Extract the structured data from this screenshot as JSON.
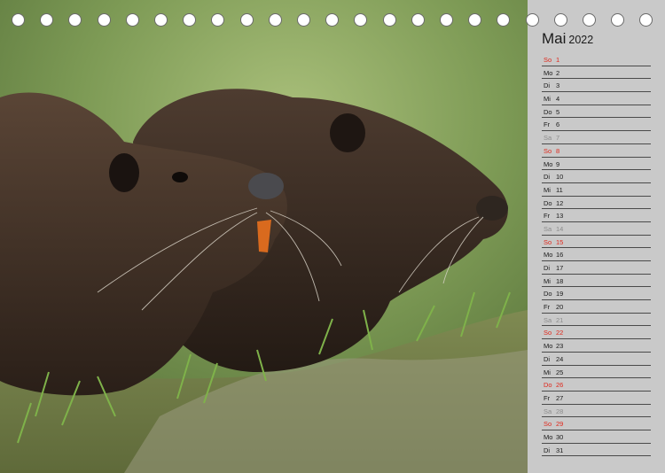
{
  "calendar": {
    "month": "Mai",
    "year": "2022",
    "days": [
      {
        "wd": "So",
        "num": "1",
        "type": "sun"
      },
      {
        "wd": "Mo",
        "num": "2",
        "type": "work"
      },
      {
        "wd": "Di",
        "num": "3",
        "type": "work"
      },
      {
        "wd": "Mi",
        "num": "4",
        "type": "work"
      },
      {
        "wd": "Do",
        "num": "5",
        "type": "work"
      },
      {
        "wd": "Fr",
        "num": "6",
        "type": "work"
      },
      {
        "wd": "Sa",
        "num": "7",
        "type": "sat"
      },
      {
        "wd": "So",
        "num": "8",
        "type": "sun"
      },
      {
        "wd": "Mo",
        "num": "9",
        "type": "work"
      },
      {
        "wd": "Di",
        "num": "10",
        "type": "work"
      },
      {
        "wd": "Mi",
        "num": "11",
        "type": "work"
      },
      {
        "wd": "Do",
        "num": "12",
        "type": "work"
      },
      {
        "wd": "Fr",
        "num": "13",
        "type": "work"
      },
      {
        "wd": "Sa",
        "num": "14",
        "type": "sat"
      },
      {
        "wd": "So",
        "num": "15",
        "type": "sun"
      },
      {
        "wd": "Mo",
        "num": "16",
        "type": "work"
      },
      {
        "wd": "Di",
        "num": "17",
        "type": "work"
      },
      {
        "wd": "Mi",
        "num": "18",
        "type": "work"
      },
      {
        "wd": "Do",
        "num": "19",
        "type": "work"
      },
      {
        "wd": "Fr",
        "num": "20",
        "type": "work"
      },
      {
        "wd": "Sa",
        "num": "21",
        "type": "sat"
      },
      {
        "wd": "So",
        "num": "22",
        "type": "sun"
      },
      {
        "wd": "Mo",
        "num": "23",
        "type": "work"
      },
      {
        "wd": "Di",
        "num": "24",
        "type": "work"
      },
      {
        "wd": "Mi",
        "num": "25",
        "type": "work"
      },
      {
        "wd": "Do",
        "num": "26",
        "type": "sun"
      },
      {
        "wd": "Fr",
        "num": "27",
        "type": "work"
      },
      {
        "wd": "Sa",
        "num": "28",
        "type": "sat"
      },
      {
        "wd": "So",
        "num": "29",
        "type": "sun"
      },
      {
        "wd": "Mo",
        "num": "30",
        "type": "work"
      },
      {
        "wd": "Di",
        "num": "31",
        "type": "work"
      }
    ]
  },
  "photo": {
    "subject": "two-nutrias-icon"
  },
  "binding": {
    "ring_count": 23
  },
  "colors": {
    "panel_bg": "#c9c9c9",
    "sunday_holiday": "#e0281c",
    "saturday": "#8c8c8c",
    "text": "#1a1a1a"
  }
}
